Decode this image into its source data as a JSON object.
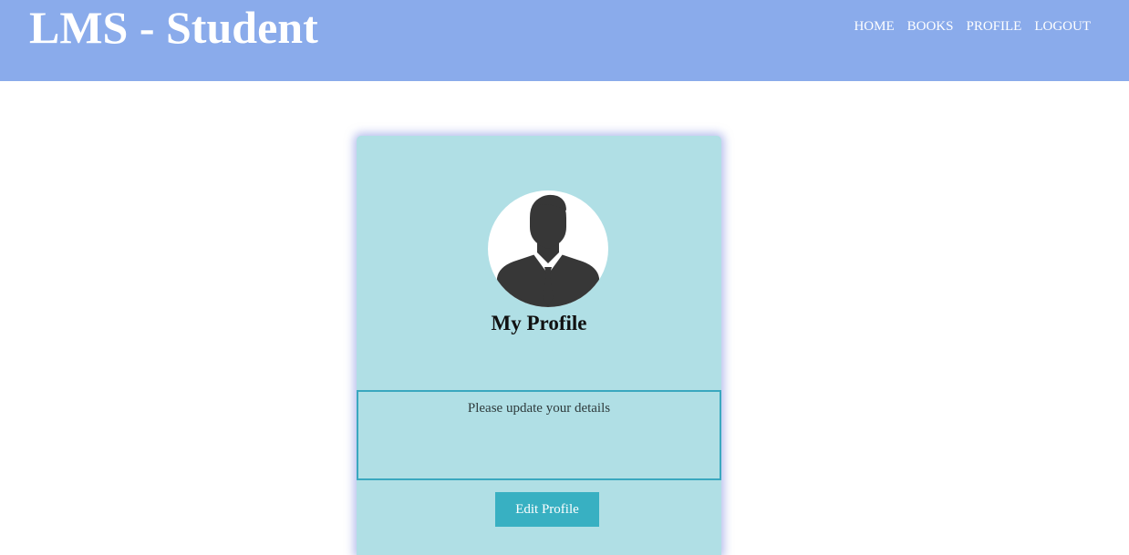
{
  "header": {
    "brand": "LMS - Student",
    "nav": [
      {
        "label": "HOME"
      },
      {
        "label": "BOOKS"
      },
      {
        "label": "PROFILE"
      },
      {
        "label": "LOGOUT"
      }
    ]
  },
  "profile_card": {
    "avatar_icon": "user-silhouette-icon",
    "title": "My Profile",
    "details_text": "Please update your details",
    "edit_button_label": "Edit Profile"
  },
  "colors": {
    "header_bg": "#8aabeb",
    "card_bg": "#b0dfe5",
    "accent": "#38b0c2",
    "details_border": "#3aa8bf"
  }
}
